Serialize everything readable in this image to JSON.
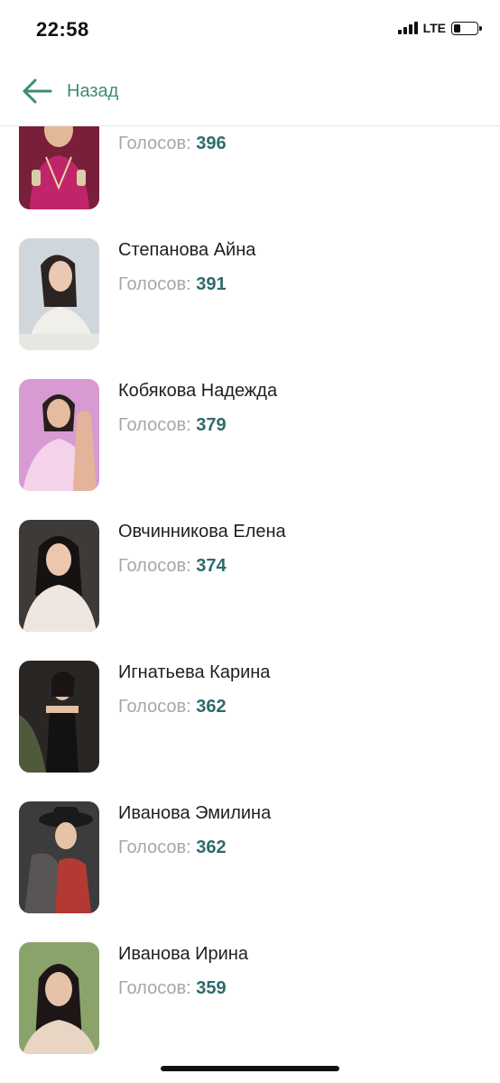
{
  "status_bar": {
    "time": "22:58",
    "network": "LTE",
    "battery_level": 0.2
  },
  "header": {
    "back_label": "Назад",
    "accent_color": "#3d8c74"
  },
  "votes_label": "Голосов:",
  "contestants": [
    {
      "name": "",
      "votes": "396",
      "photo_bg": "#7a1f3a",
      "photo_accent": "#c0256a"
    },
    {
      "name": "Степанова Айна",
      "votes": "391",
      "photo_bg": "#cfd6dc",
      "photo_accent": "#f1efe9"
    },
    {
      "name": "Кобякова Надежда",
      "votes": "379",
      "photo_bg": "#d79ad3",
      "photo_accent": "#f3d2ea"
    },
    {
      "name": "Овчинникова Елена",
      "votes": "374",
      "photo_bg": "#3e3a38",
      "photo_accent": "#efe7df"
    },
    {
      "name": "Игнатьева Карина",
      "votes": "362",
      "photo_bg": "#2a2624",
      "photo_accent": "#121212"
    },
    {
      "name": "Иванова Эмилина",
      "votes": "362",
      "photo_bg": "#3c3c3e",
      "photo_accent": "#b23a33"
    },
    {
      "name": "Иванова Ирина",
      "votes": "359",
      "photo_bg": "#8aa36b",
      "photo_accent": "#e8d5c4"
    }
  ]
}
